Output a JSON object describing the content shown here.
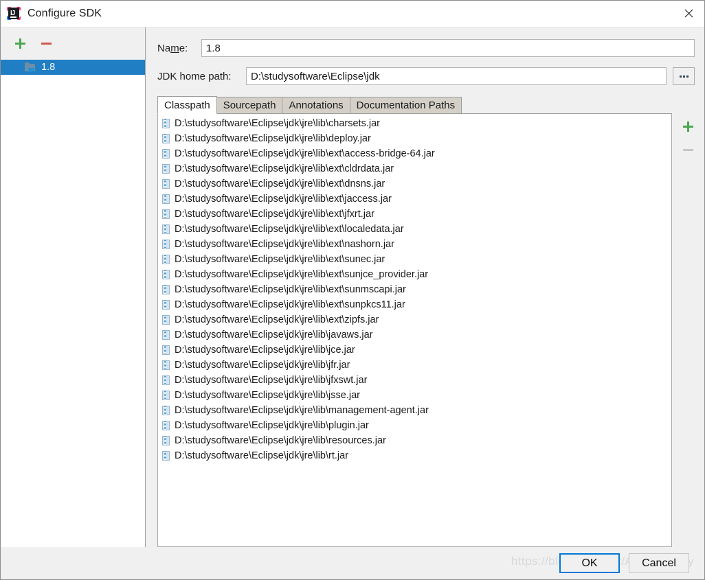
{
  "window": {
    "title": "Configure SDK",
    "app_icon": "intellij-idea-icon",
    "close_icon": "close-icon"
  },
  "sidebar": {
    "add_label": "+",
    "remove_label": "−",
    "items": [
      {
        "label": "1.8",
        "icon": "jdk-folder-icon",
        "selected": true
      }
    ]
  },
  "form": {
    "name": {
      "label_pre": "Na",
      "label_mnemonic": "m",
      "label_post": "e:",
      "value": "1.8"
    },
    "jdk_home": {
      "label": "JDK home path:",
      "value": "D:\\studysoftware\\Eclipse\\jdk",
      "browse_label": "..."
    }
  },
  "tabs": [
    {
      "label": "Classpath",
      "active": true
    },
    {
      "label": "Sourcepath",
      "active": false
    },
    {
      "label": "Annotations",
      "active": false
    },
    {
      "label": "Documentation Paths",
      "active": false
    }
  ],
  "classpath": {
    "add_label": "+",
    "remove_label": "−",
    "entries": [
      "D:\\studysoftware\\Eclipse\\jdk\\jre\\lib\\charsets.jar",
      "D:\\studysoftware\\Eclipse\\jdk\\jre\\lib\\deploy.jar",
      "D:\\studysoftware\\Eclipse\\jdk\\jre\\lib\\ext\\access-bridge-64.jar",
      "D:\\studysoftware\\Eclipse\\jdk\\jre\\lib\\ext\\cldrdata.jar",
      "D:\\studysoftware\\Eclipse\\jdk\\jre\\lib\\ext\\dnsns.jar",
      "D:\\studysoftware\\Eclipse\\jdk\\jre\\lib\\ext\\jaccess.jar",
      "D:\\studysoftware\\Eclipse\\jdk\\jre\\lib\\ext\\jfxrt.jar",
      "D:\\studysoftware\\Eclipse\\jdk\\jre\\lib\\ext\\localedata.jar",
      "D:\\studysoftware\\Eclipse\\jdk\\jre\\lib\\ext\\nashorn.jar",
      "D:\\studysoftware\\Eclipse\\jdk\\jre\\lib\\ext\\sunec.jar",
      "D:\\studysoftware\\Eclipse\\jdk\\jre\\lib\\ext\\sunjce_provider.jar",
      "D:\\studysoftware\\Eclipse\\jdk\\jre\\lib\\ext\\sunmscapi.jar",
      "D:\\studysoftware\\Eclipse\\jdk\\jre\\lib\\ext\\sunpkcs11.jar",
      "D:\\studysoftware\\Eclipse\\jdk\\jre\\lib\\ext\\zipfs.jar",
      "D:\\studysoftware\\Eclipse\\jdk\\jre\\lib\\javaws.jar",
      "D:\\studysoftware\\Eclipse\\jdk\\jre\\lib\\jce.jar",
      "D:\\studysoftware\\Eclipse\\jdk\\jre\\lib\\jfr.jar",
      "D:\\studysoftware\\Eclipse\\jdk\\jre\\lib\\jfxswt.jar",
      "D:\\studysoftware\\Eclipse\\jdk\\jre\\lib\\jsse.jar",
      "D:\\studysoftware\\Eclipse\\jdk\\jre\\lib\\management-agent.jar",
      "D:\\studysoftware\\Eclipse\\jdk\\jre\\lib\\plugin.jar",
      "D:\\studysoftware\\Eclipse\\jdk\\jre\\lib\\resources.jar",
      "D:\\studysoftware\\Eclipse\\jdk\\jre\\lib\\rt.jar"
    ]
  },
  "footer": {
    "ok_label": "OK",
    "cancel_label": "Cancel",
    "watermark": "https://blog.csdn.net/A_Td_daddy"
  },
  "colors": {
    "selection_blue": "#1f7ec4",
    "focus_blue": "#0078d7",
    "add_green": "#49a84c",
    "remove_red": "#d0584f",
    "dialog_bg": "#f0f0f0"
  }
}
